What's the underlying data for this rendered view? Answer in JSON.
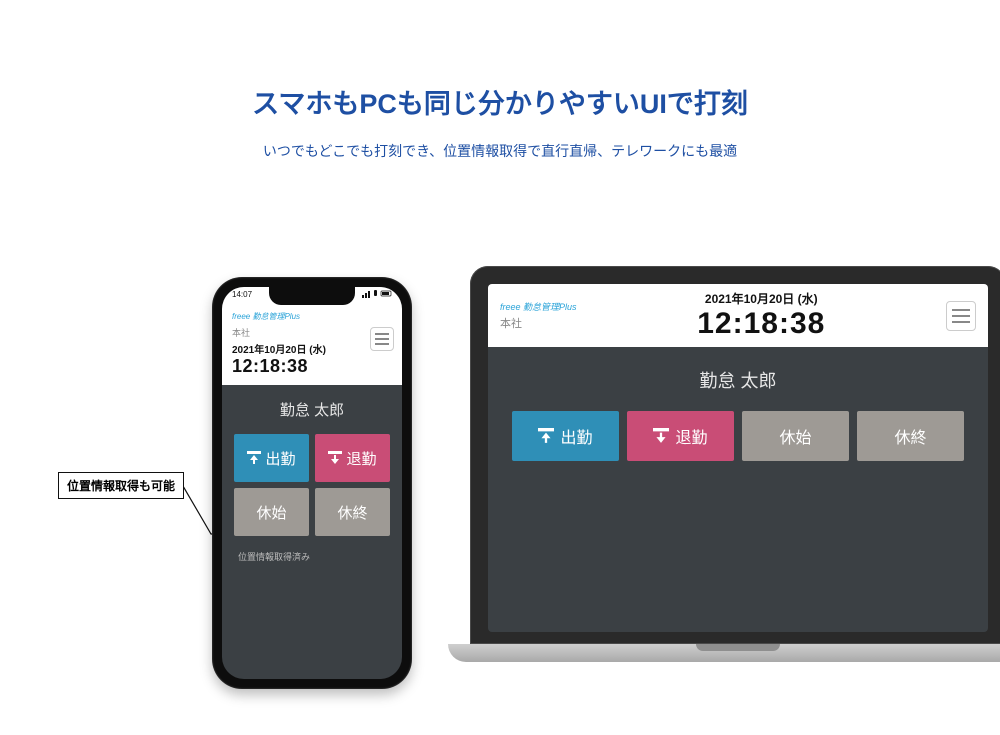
{
  "page": {
    "headline": "スマホもPCも同じ分かりやすいUIで打刻",
    "subhead": "いつでもどこでも打刻でき、位置情報取得で直行直帰、テレワークにも最適",
    "annotation": "位置情報取得も可能"
  },
  "phone": {
    "status_time": "14:07",
    "brand": "freee 勤怠管理Plus",
    "location": "本社",
    "date": "2021年10月20日 (水)",
    "time": "12:18:38",
    "user": "勤怠 太郎",
    "buttons": {
      "clock_in": "出勤",
      "clock_out": "退勤",
      "break_start": "休始",
      "break_end": "休終"
    },
    "geo_status": "位置情報取得済み"
  },
  "laptop": {
    "brand": "freee 勤怠管理Plus",
    "location": "本社",
    "date": "2021年10月20日 (水)",
    "time": "12:18:38",
    "user": "勤怠 太郎",
    "buttons": {
      "clock_in": "出勤",
      "clock_out": "退勤",
      "break_start": "休始",
      "break_end": "休終"
    }
  }
}
